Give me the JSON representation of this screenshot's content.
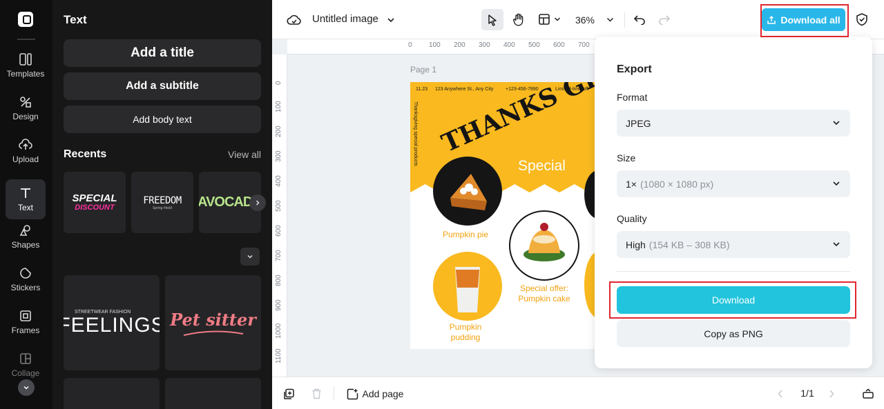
{
  "rail": {
    "items": [
      {
        "label": "Templates",
        "icon": "templates-icon"
      },
      {
        "label": "Design",
        "icon": "design-icon"
      },
      {
        "label": "Upload",
        "icon": "upload-icon"
      },
      {
        "label": "Text",
        "icon": "text-icon"
      },
      {
        "label": "Shapes",
        "icon": "shapes-icon"
      },
      {
        "label": "Stickers",
        "icon": "stickers-icon"
      },
      {
        "label": "Frames",
        "icon": "frames-icon"
      },
      {
        "label": "Collage",
        "icon": "collage-icon"
      }
    ],
    "active": "Text"
  },
  "panel": {
    "title": "Text",
    "add_title": "Add a title",
    "add_subtitle": "Add a subtitle",
    "add_body": "Add body text",
    "recents_heading": "Recents",
    "view_all": "View all",
    "recents": [
      "SPECIAL",
      "DISCOUNT",
      "FREEDOM",
      "Spring #bold",
      "AVOCADO"
    ],
    "presets": [
      "STREETWEAR FASHION",
      "FEELINGS",
      "Pet sitter"
    ]
  },
  "topbar": {
    "doc_title": "Untitled image",
    "zoom": "36%",
    "download_all": "Download all"
  },
  "canvas": {
    "page_label": "Page 1",
    "ruler_top": [
      "0",
      "100",
      "200",
      "300",
      "400",
      "500",
      "600",
      "700"
    ],
    "ruler_left": [
      "0",
      "100",
      "200",
      "300",
      "400",
      "500",
      "600",
      "700",
      "800",
      "900",
      "1000",
      "1100"
    ],
    "artwork": {
      "date": "11.23",
      "address": "123 Anywhere St., Any City",
      "phone": "+123-456-7890",
      "offer_note": "Limited-time off",
      "side_text": "Thanksgiving special products",
      "headline": "THANKS GI",
      "special": "Special",
      "items": [
        {
          "caption_1": "Pumpkin pie",
          "caption_2": ""
        },
        {
          "caption_1": "Special offer:",
          "caption_2": "Pumpkin cake"
        },
        {
          "caption_1": "Pumpkin",
          "caption_2": "pudding"
        }
      ]
    }
  },
  "export": {
    "title": "Export",
    "format_label": "Format",
    "format_value": "JPEG",
    "size_label": "Size",
    "size_value": "1×",
    "size_detail": "(1080 × 1080 px)",
    "quality_label": "Quality",
    "quality_value": "High",
    "quality_detail": "(154 KB – 308 KB)",
    "download": "Download",
    "copy_png": "Copy as PNG"
  },
  "bottombar": {
    "add_page": "Add page",
    "page_count": "1/1"
  },
  "colors": {
    "accent": "#29b7e9",
    "download": "#21c4dc",
    "highlight": "#e0262f",
    "art_yellow": "#f9b91f"
  }
}
